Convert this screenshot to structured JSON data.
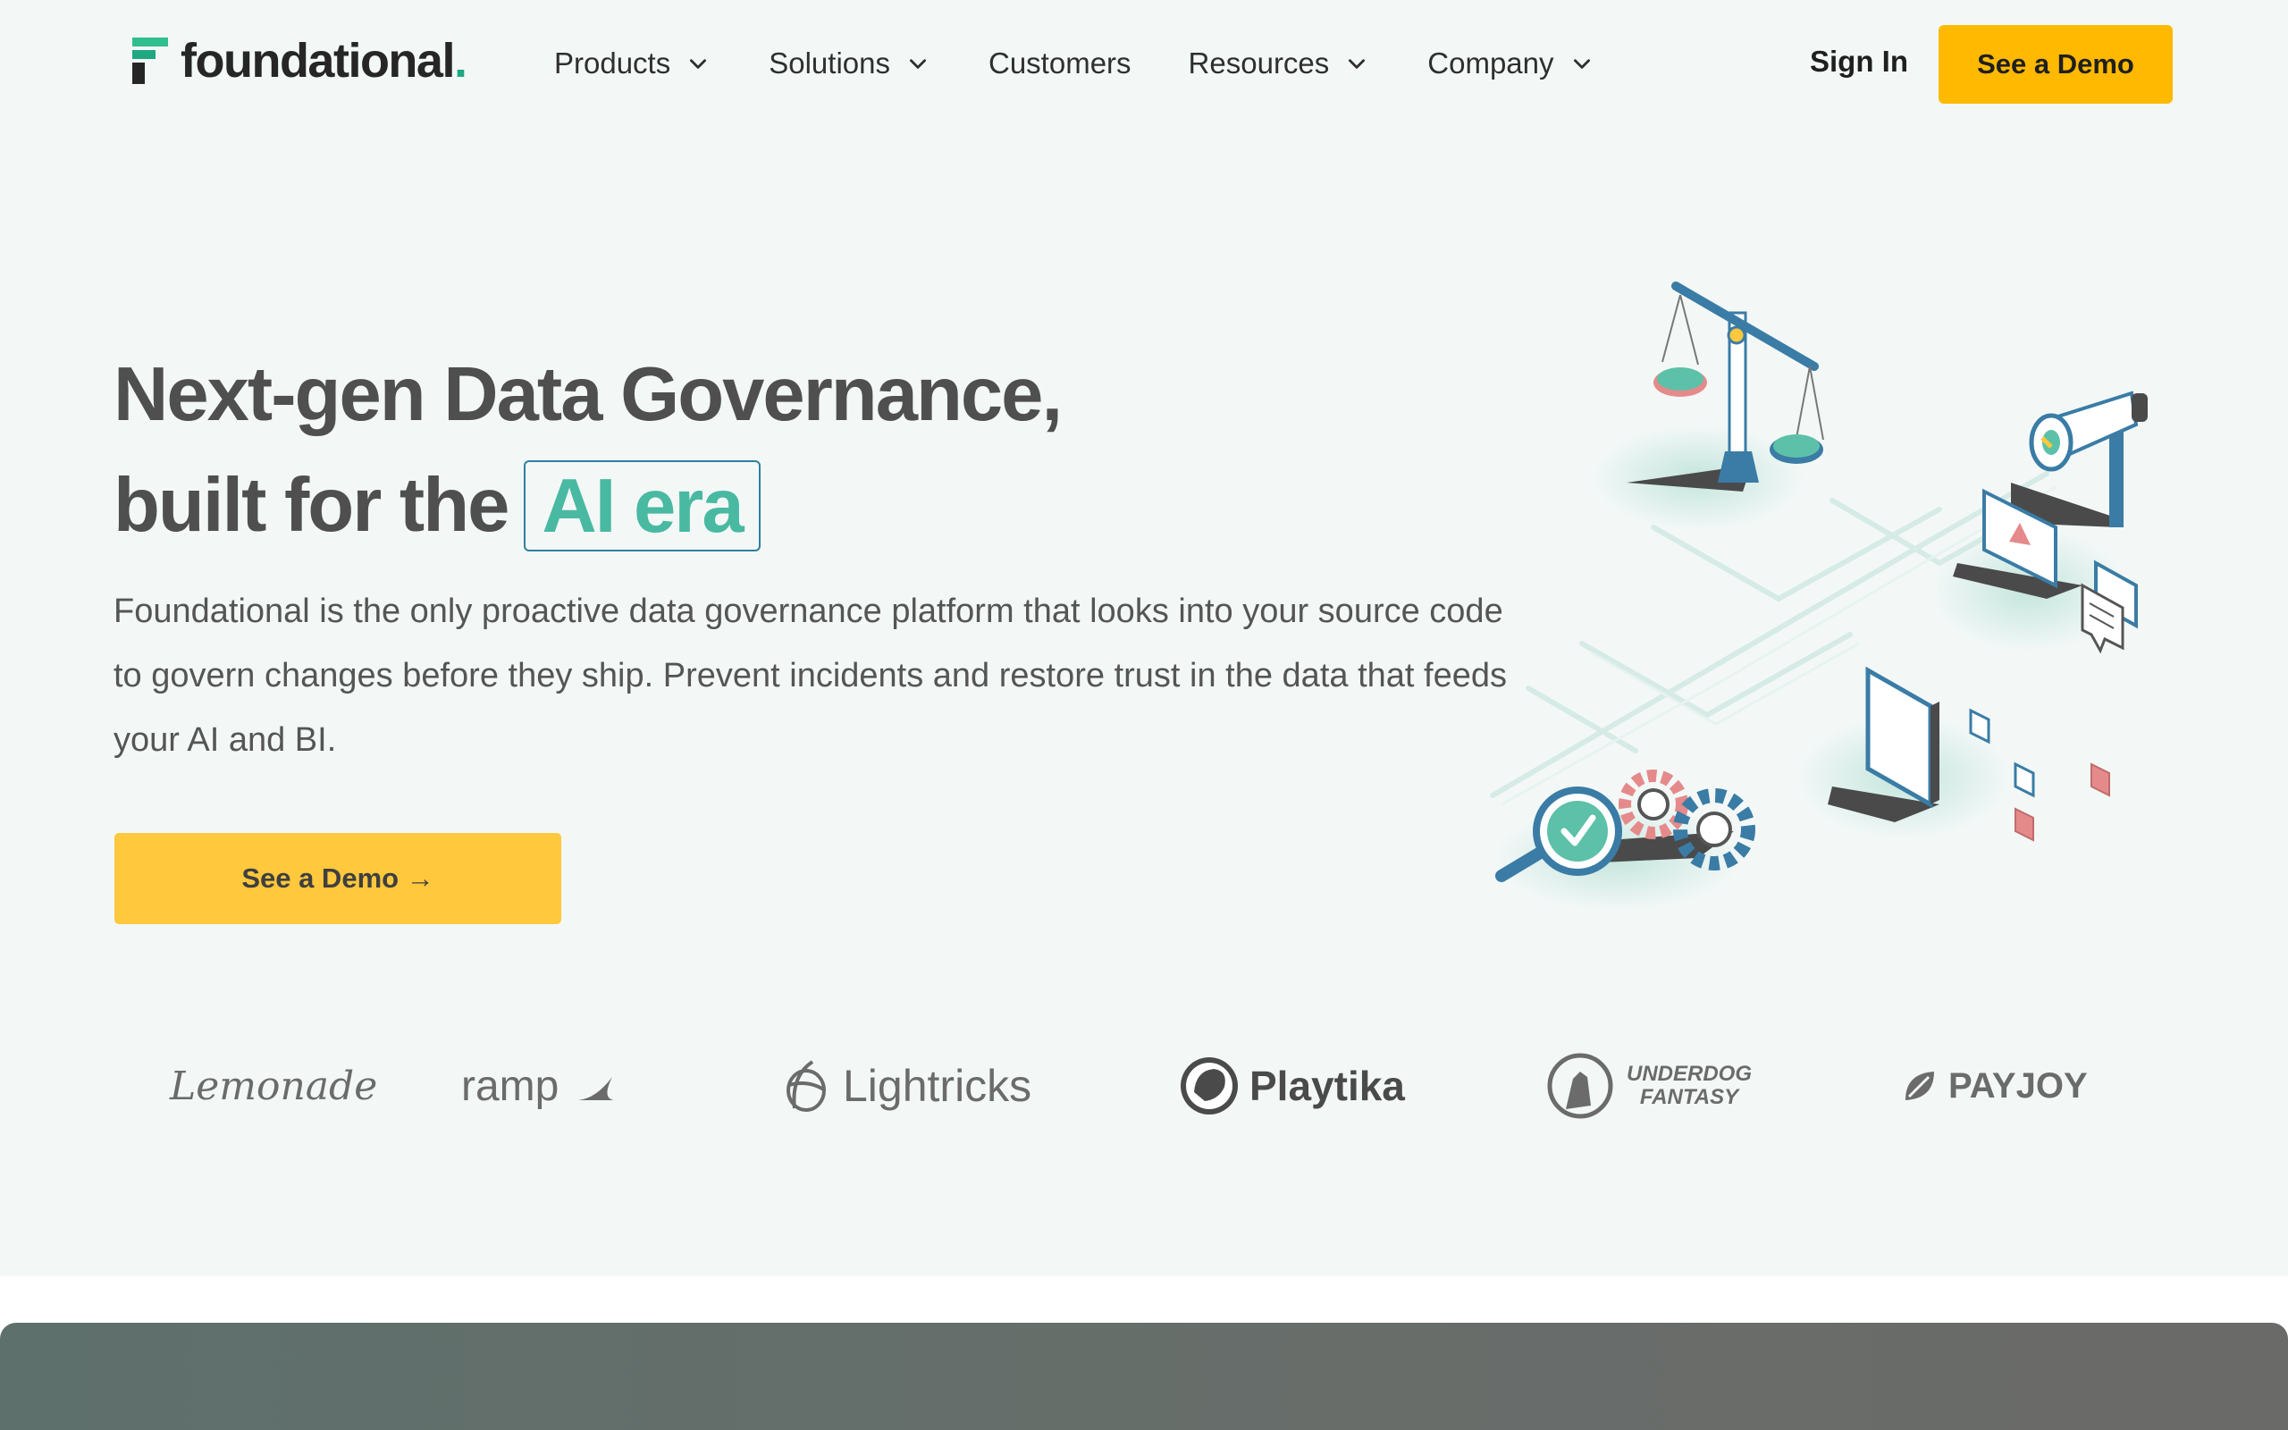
{
  "nav": {
    "logo_text": "foundational",
    "logo_dot": ".",
    "items": [
      {
        "label": "Products",
        "has_dropdown": true
      },
      {
        "label": "Solutions",
        "has_dropdown": true
      },
      {
        "label": "Customers",
        "has_dropdown": false
      },
      {
        "label": "Resources",
        "has_dropdown": true
      },
      {
        "label": "Company",
        "has_dropdown": true
      }
    ],
    "sign_in": "Sign In",
    "demo_button": "See a Demo"
  },
  "hero": {
    "headline_line1": "Next-gen Data Governance,",
    "headline_line2_prefix": "built for the",
    "headline_highlight": "AI era",
    "subtext": "Foundational is the only proactive data governance platform that looks into your source code to govern changes before they ship. Prevent incidents and restore trust in the data that feeds your AI and BI.",
    "cta": "See a Demo →"
  },
  "customers": {
    "logos": [
      {
        "name": "Lemonade",
        "text": "Lemonade"
      },
      {
        "name": "Ramp",
        "text": "ramp"
      },
      {
        "name": "Lightricks",
        "text": "Lightricks"
      },
      {
        "name": "Playtika",
        "text": "Playtika"
      },
      {
        "name": "Underdog Fantasy",
        "text_line1": "UNDERDOG",
        "text_line2": "FANTASY"
      },
      {
        "name": "PayJoy",
        "text": "PAYJOY"
      }
    ]
  },
  "colors": {
    "accent_yellow": "#ffb900",
    "cta_yellow": "#ffc83d",
    "brand_green": "#1fa882",
    "highlight_teal": "#49b9a2",
    "highlight_border": "#2f7fa0",
    "hero_background": "#f3f8f7"
  },
  "icons": [
    "chevron-down-icon",
    "arrow-right-icon",
    "scale-icon",
    "megaphone-icon",
    "warning-icon",
    "chat-icon",
    "document-icon",
    "magnifier-check-icon",
    "gears-icon"
  ]
}
